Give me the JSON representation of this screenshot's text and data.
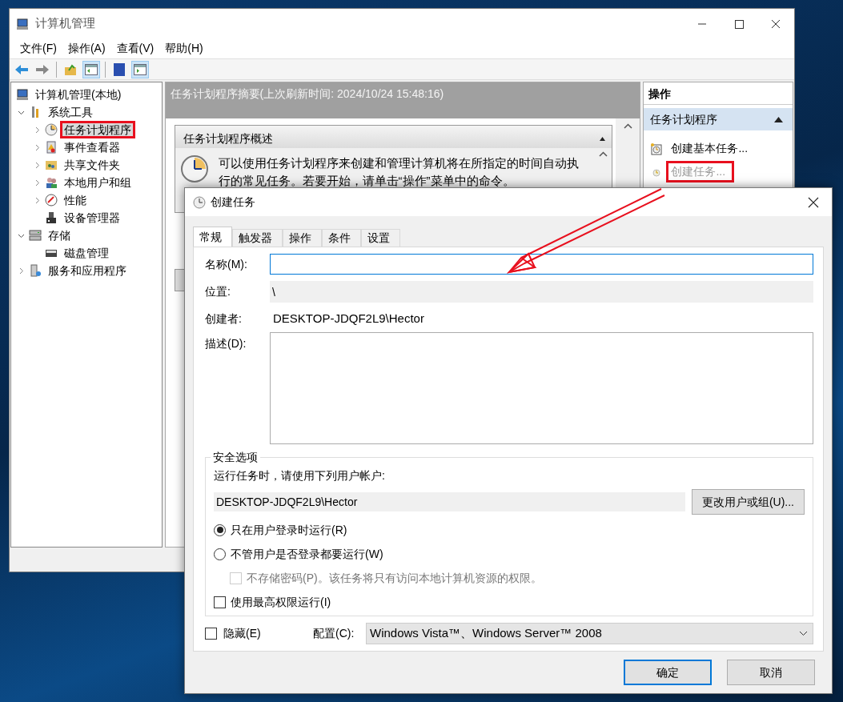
{
  "window": {
    "title": "计算机管理"
  },
  "menu": [
    "文件(F)",
    "操作(A)",
    "查看(V)",
    "帮助(H)"
  ],
  "tree": [
    {
      "label": "计算机管理(本地)",
      "kind": "computer",
      "selected": false,
      "children": [
        {
          "label": "系统工具",
          "kind": "tools",
          "expanded": true,
          "selected": false,
          "children": [
            {
              "label": "任务计划程序",
              "kind": "clock",
              "expanded": false,
              "selected": true,
              "highlighted": true
            },
            {
              "label": "事件查看器",
              "kind": "log",
              "expanded": false,
              "selected": false
            },
            {
              "label": "共享文件夹",
              "kind": "folder",
              "expanded": false,
              "selected": false
            },
            {
              "label": "本地用户和组",
              "kind": "users",
              "expanded": false,
              "selected": false
            },
            {
              "label": "性能",
              "kind": "gauge",
              "expanded": false,
              "selected": false
            },
            {
              "label": "设备管理器",
              "kind": "device",
              "selected": false
            }
          ]
        },
        {
          "label": "存储",
          "kind": "storage",
          "expanded": true,
          "selected": false,
          "children": [
            {
              "label": "磁盘管理",
              "kind": "disk",
              "selected": false
            }
          ]
        },
        {
          "label": "服务和应用程序",
          "kind": "services",
          "expanded": false,
          "selected": false
        }
      ]
    }
  ],
  "summary": {
    "header": "任务计划程序摘要(上次刷新时间: 2024/10/24 15:48:16)",
    "section_title": "任务计划程序概述",
    "text": "可以使用任务计划程序来创建和管理计算机将在所指定的时间自动执行的常见任务。若要开始，请单击“操作”菜单中的命令。"
  },
  "actions": {
    "title": "操作",
    "group": "任务计划程序",
    "items": [
      {
        "label": "创建基本任务...",
        "disabled": false,
        "highlighted": false
      },
      {
        "label": "创建任务...",
        "disabled": true,
        "highlighted": true
      }
    ]
  },
  "dialog": {
    "title": "创建任务",
    "tabs": [
      {
        "label": "常规",
        "selected": true
      },
      {
        "label": "触发器",
        "selected": false
      },
      {
        "label": "操作",
        "selected": false
      },
      {
        "label": "条件",
        "selected": false
      },
      {
        "label": "设置",
        "selected": false
      }
    ],
    "name_label": "名称(M):",
    "location_label": "位置:",
    "location_value": "\\",
    "author_label": "创建者:",
    "author_value": "DESKTOP-JDQF2L9\\Hector",
    "description_label": "描述(D):",
    "security": {
      "title": "安全选项",
      "prompt": "运行任务时，请使用下列用户帐户:",
      "account": "DESKTOP-JDQF2L9\\Hector",
      "change_button": "更改用户或组(U)...",
      "options": [
        {
          "kind": "radio",
          "label": "只在用户登录时运行(R)",
          "selected": true
        },
        {
          "kind": "radio",
          "label": "不管用户是否登录都要运行(W)",
          "selected": false
        },
        {
          "kind": "subcheck",
          "label": "不存储密码(P)。该任务将只有访问本地计算机资源的权限。",
          "checked": false,
          "disabled": true
        },
        {
          "kind": "checkbox",
          "label": "使用最高权限运行(I)",
          "checked": false
        }
      ]
    },
    "hidden": {
      "label": "隐藏(E)",
      "checked": false
    },
    "config": {
      "label": "配置(C):",
      "value": "Windows Vista™、Windows Server™ 2008"
    },
    "buttons": [
      {
        "label": "确定",
        "default": true
      },
      {
        "label": "取消",
        "default": false
      }
    ]
  }
}
